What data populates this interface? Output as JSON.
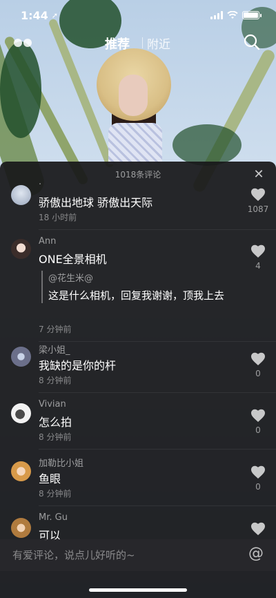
{
  "status_bar": {
    "time": "1:44",
    "location_icon": "location-arrow-icon"
  },
  "top_nav": {
    "tabs": [
      {
        "label": "推荐",
        "active": true
      },
      {
        "label": "附近",
        "active": false
      }
    ],
    "left_icon": "dots-icon",
    "right_icon": "search-icon"
  },
  "comments_panel": {
    "title": "1018条评论",
    "close_icon": "close-icon",
    "comments": [
      {
        "name": "·",
        "text": "骄傲出地球 骄傲出天际",
        "time": "18 小时前",
        "likes": "1087"
      },
      {
        "name": "Ann",
        "text": "ONE全景相机",
        "reply": {
          "name": "@花生米@",
          "text": "这是什么相机，回复我谢谢，顶我上去"
        },
        "time": "7 分钟前",
        "likes": "4"
      },
      {
        "name": "梁小姐_",
        "text": "我缺的是你的杆",
        "time": "8 分钟前",
        "likes": "0"
      },
      {
        "name": "Vivian",
        "text": "怎么拍",
        "time": "8 分钟前",
        "likes": "0"
      },
      {
        "name": "加勒比小姐",
        "text": "鱼眼",
        "time": "8 分钟前",
        "likes": "0"
      },
      {
        "name": "Mr. Gu",
        "text": "可以",
        "time": "",
        "likes": ""
      }
    ],
    "input_placeholder": "有爱评论，说点儿好听的~",
    "at_icon": "at-icon"
  },
  "colors": {
    "panel_bg": "#18181a",
    "text_primary": "#ffffff",
    "text_secondary": "#8c8c8c"
  }
}
